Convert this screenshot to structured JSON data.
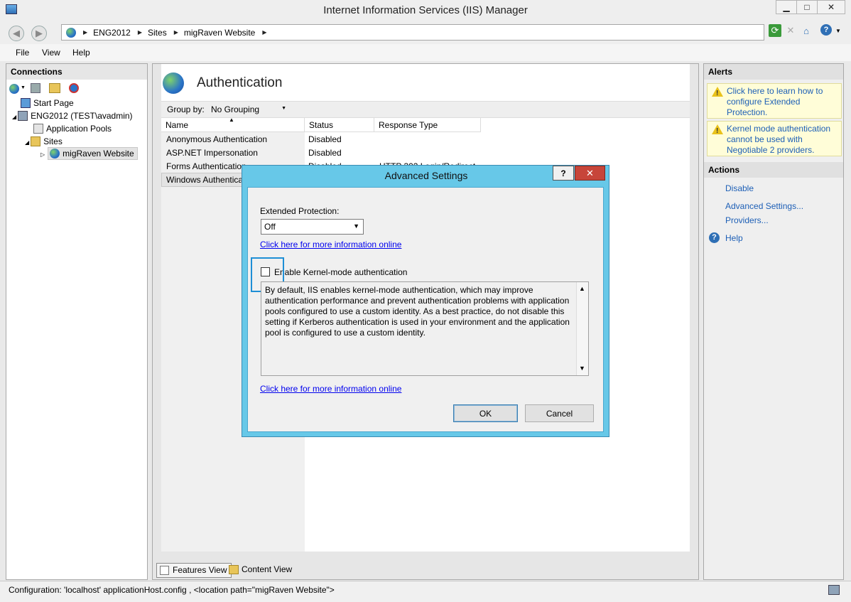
{
  "window": {
    "title": "Internet Information Services (IIS) Manager"
  },
  "titlebar_buttons": {
    "minimize": "▁",
    "maximize": "□",
    "close": "✕"
  },
  "address": {
    "items": [
      "ENG2012",
      "Sites",
      "migRaven Website"
    ]
  },
  "menu": [
    "File",
    "View",
    "Help"
  ],
  "connections": {
    "title": "Connections",
    "tree": [
      {
        "label": "Start Page",
        "level": 1,
        "icon": "start-page-icon"
      },
      {
        "label": "ENG2012 (TEST\\avadmin)",
        "level": 1,
        "icon": "server-icon"
      },
      {
        "label": "Application Pools",
        "level": 2,
        "icon": "app-pools-icon"
      },
      {
        "label": "Sites",
        "level": 2,
        "icon": "sites-folder-icon"
      },
      {
        "label": "migRaven Website",
        "level": 3,
        "icon": "globe-icon"
      }
    ]
  },
  "main": {
    "title": "Authentication",
    "groupby_label": "Group by:",
    "groupby_value": "No Grouping",
    "columns": [
      "Name",
      "Status",
      "Response Type"
    ],
    "rows": [
      {
        "name": "Anonymous Authentication",
        "status": "Disabled",
        "response": ""
      },
      {
        "name": "ASP.NET Impersonation",
        "status": "Disabled",
        "response": ""
      },
      {
        "name": "Forms Authentication",
        "status": "Disabled",
        "response": "HTTP 302 Login/Redirect"
      },
      {
        "name": "Windows Authentication",
        "status": "",
        "response": ""
      }
    ]
  },
  "tabs": {
    "features": "Features View",
    "content": "Content View"
  },
  "alerts": {
    "title": "Alerts",
    "items": [
      "Click here to learn how to configure Extended Protection.",
      "Kernel mode authentication cannot be used with Negotiable 2  providers."
    ]
  },
  "actions": {
    "title": "Actions",
    "items": [
      "Disable",
      "Advanced Settings...",
      "Providers...",
      "Help"
    ]
  },
  "status": {
    "text": "Configuration: 'localhost' applicationHost.config , <location path=\"migRaven Website\">"
  },
  "dialog": {
    "title": "Advanced Settings",
    "help": "?",
    "close": "✕",
    "extended_protection_label": "Extended Protection:",
    "extended_protection_value": "Off",
    "info_link": "Click here for more information online",
    "kernel_checkbox_label": "Enable Kernel-mode authentication",
    "kernel_checked": false,
    "description": "By default, IIS enables kernel-mode authentication, which may improve authentication performance and prevent authentication problems with application pools configured to use a custom identity. As a best practice, do not disable this setting if Kerberos authentication is used in your environment and the application pool is configured to use a custom identity.",
    "info_link2": "Click here for more information online",
    "ok": "OK",
    "cancel": "Cancel"
  },
  "colors": {
    "dialog_frame": "#67c8e8",
    "link": "#1d5fb6",
    "highlight": "#1e8fd6",
    "alert_bg": "#fffdd8"
  }
}
